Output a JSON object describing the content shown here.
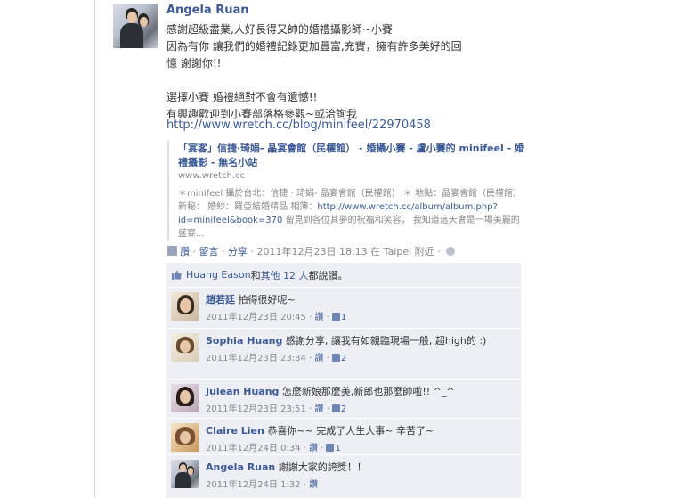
{
  "post": {
    "author": "Angela Ruan",
    "lines": [
      "感謝超級盡業,人好長得又帥的婚禮攝影師~小賽",
      "因為有你 讓我們的婚禮記錄更加豐富,充實，擁有許多美好的回",
      "憶 謝謝你!!",
      "",
      "選擇小賽 婚禮絕對不會有遺憾!!",
      "有興趣歡迎到小賽部落格參觀~或洽詢我"
    ],
    "link": "http://www.wretch.cc/blog/minifeel/22970458"
  },
  "share": {
    "title": "「宴客」信捷‧琦娟- 晶宴會館（民權館） - 婚攝小賽 - 盧小賽的 minifeel - 婚禮攝影 - 無名小站",
    "domain": "www.wretch.cc",
    "desc_pre": "＊minifeel 攝於台北：信捷 ‧ 琦娟- 晶宴會館（民權館） ＊ 地點：晶宴會館（民權館） 新秘： 婚紗：羅亞結婚精品 相簿：",
    "desc_link": "http://www.wretch.cc/album/album.php?id=minifeel&book=370",
    "desc_post": " 留見到各位其夢的祝福和笑容， 我知道這天會是一場美麗的盛宴..."
  },
  "actions": {
    "like": "讚",
    "sep": " · ",
    "comment": "留言",
    "share": "分享",
    "timestamp": " · 2011年12月23日 18:13 在 Taipei 附近 · "
  },
  "likes": {
    "name": "Huang Eason",
    "mid": " 和",
    "others": "其他 12 人",
    "tail": "都說讚。"
  },
  "comments": [
    {
      "name": "趙若廷",
      "text": "拍得很好呢~",
      "time": "2011年12月23日 20:45",
      "like": "讚",
      "count": "1"
    },
    {
      "name": "Sophia Huang",
      "text": "感謝分享, 讓我有如親臨現場一般, 超high的 :)",
      "time": "2011年12月23日 23:34",
      "like": "讚",
      "count": "2"
    },
    {
      "name": "Julean Huang",
      "text": "怎麼新娘那麼美,新郎也那麼帥啦!! ^_^",
      "time": "2011年12月23日 23:51",
      "like": "讚",
      "count": "2"
    },
    {
      "name": "Claire Lien",
      "text": "恭喜你~~ 完成了人生大事~ 辛苦了~",
      "time": "2011年12月24日 0:34",
      "like": "讚",
      "count": "1"
    },
    {
      "name": "Angela Ruan",
      "text": "謝謝大家的誇獎！！",
      "time": "2011年12月24日 1:32",
      "like": "讚",
      "count": ""
    }
  ]
}
